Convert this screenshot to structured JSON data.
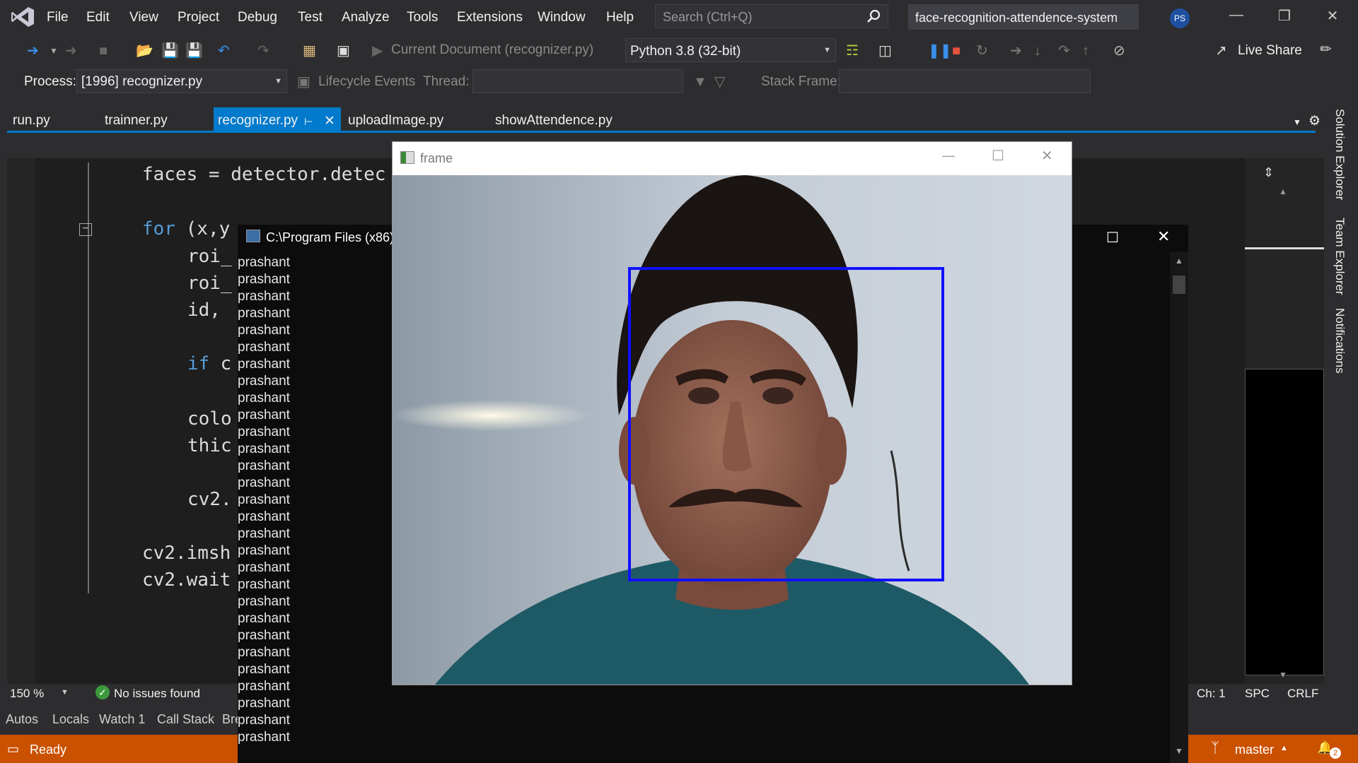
{
  "menu": {
    "items": [
      "File",
      "Edit",
      "View",
      "Project",
      "Debug",
      "Test",
      "Analyze",
      "Tools",
      "Extensions",
      "Window",
      "Help"
    ],
    "search_placeholder": "Search (Ctrl+Q)",
    "solution_name": "face-recognition-attendence-system",
    "avatar_initials": "PS"
  },
  "toolbar": {
    "current_document": "Current Document (recognizer.py)",
    "python_env": "Python 3.8 (32-bit)",
    "live_share": "Live Share"
  },
  "debug_toolbar": {
    "process_label": "Process:",
    "process_value": "[1996] recognizer.py",
    "lifecycle_label": "Lifecycle Events",
    "thread_label": "Thread:",
    "stack_frame_label": "Stack Frame:"
  },
  "tabs": [
    {
      "label": "run.py"
    },
    {
      "label": "trainner.py"
    },
    {
      "label": "recognizer.py"
    },
    {
      "label": "uploadImage.py"
    },
    {
      "label": "showAttendence.py"
    }
  ],
  "code_lines": {
    "l1": "faces = detector.detec",
    "l2_kw": "for",
    "l2": " (x,y",
    "l3": "roi_",
    "l4": "roi_",
    "l5": "id, ",
    "l6_kw": "if",
    "l6": " c",
    "l7": "colo",
    "l8": "thic",
    "l9": "cv2.",
    "l10": "cv2.imsh",
    "l11": "cv2.wait"
  },
  "editor_status": {
    "zoom": "150 %",
    "issues": "No issues found",
    "column": "Ch: 1",
    "spacing": "SPC",
    "line_ending": "CRLF"
  },
  "tool_tabs": [
    "Autos",
    "Locals",
    "Watch 1",
    "Call Stack",
    "Bre"
  ],
  "status_bar": {
    "ready": "Ready",
    "branch": "master",
    "notifications_count": "2"
  },
  "right_rail": [
    "Solution Explorer",
    "Team Explorer",
    "Notifications"
  ],
  "console": {
    "title": "C:\\Program Files (x86)\\",
    "lines": [
      "prashant",
      "prashant",
      "prashant",
      "prashant",
      "prashant",
      "prashant",
      "prashant",
      "prashant",
      "prashant",
      "prashant",
      "prashant",
      "prashant",
      "prashant",
      "prashant",
      "prashant",
      "prashant",
      "prashant",
      "prashant",
      "prashant",
      "prashant",
      "prashant",
      "prashant",
      "prashant",
      "prashant",
      "prashant",
      "prashant",
      "prashant",
      "prashant",
      "prashant"
    ]
  },
  "frame_window": {
    "title": "frame"
  },
  "colors": {
    "accent": "#007acc",
    "status_bar": "#ca5100",
    "detection_box": "#1010ff"
  }
}
